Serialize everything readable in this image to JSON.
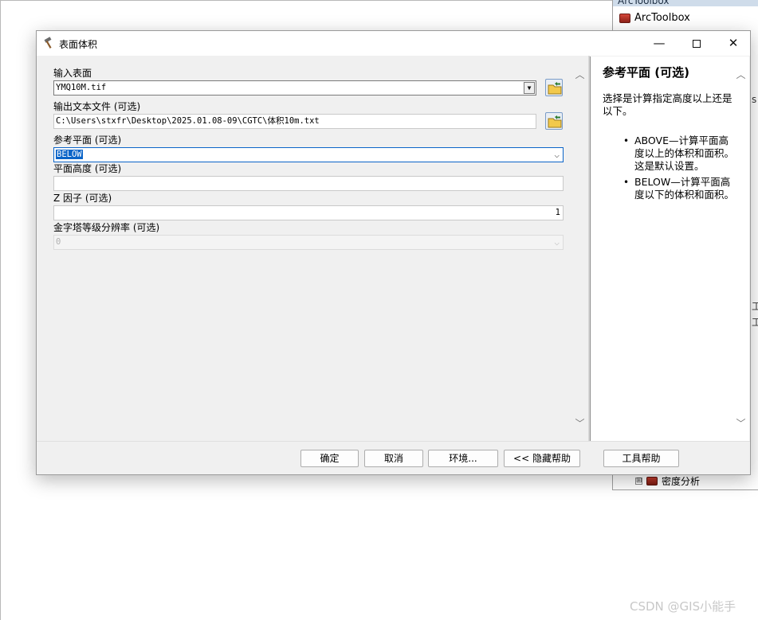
{
  "toolbox": {
    "title": "ArcToolbox",
    "root_label": "ArcToolbox",
    "density_expander": "⊞",
    "density_label": "密度分析",
    "frag1": "工",
    "frag2": "工",
    "frag3": "s"
  },
  "dialog": {
    "title": "表面体积",
    "min_glyph": "—",
    "close_glyph": "✕"
  },
  "params": {
    "input_surface": {
      "label": "输入表面",
      "value": "YMQ10M.tif"
    },
    "output_text_file": {
      "label": "输出文本文件 (可选)",
      "value": "C:\\Users\\stxfr\\Desktop\\2025.01.08-09\\CGTC\\体积10m.txt"
    },
    "reference_plane": {
      "label": "参考平面 (可选)",
      "value": "BELOW"
    },
    "plane_height": {
      "label": "平面高度 (可选)",
      "value": ""
    },
    "z_factor": {
      "label": "Z 因子 (可选)",
      "value": "1"
    },
    "pyramid_resolution": {
      "label": "金字塔等级分辨率 (可选)",
      "value": "0"
    },
    "dropdown_glyph": "▼",
    "chevron_glyph": "⌵",
    "scroll_up": "︿",
    "scroll_down": "﹀"
  },
  "help": {
    "title": "参考平面 (可选)",
    "description": "选择是计算指定高度以上还是以下。",
    "items": [
      "ABOVE—计算平面高度以上的体积和面积。这是默认设置。",
      "BELOW—计算平面高度以下的体积和面积。"
    ],
    "bullet": "•"
  },
  "buttons": {
    "ok": "确定",
    "cancel": "取消",
    "environments": "环境...",
    "hide_help": "<< 隐藏帮助",
    "tool_help": "工具帮助"
  },
  "watermark": "CSDN @GIS小能手"
}
